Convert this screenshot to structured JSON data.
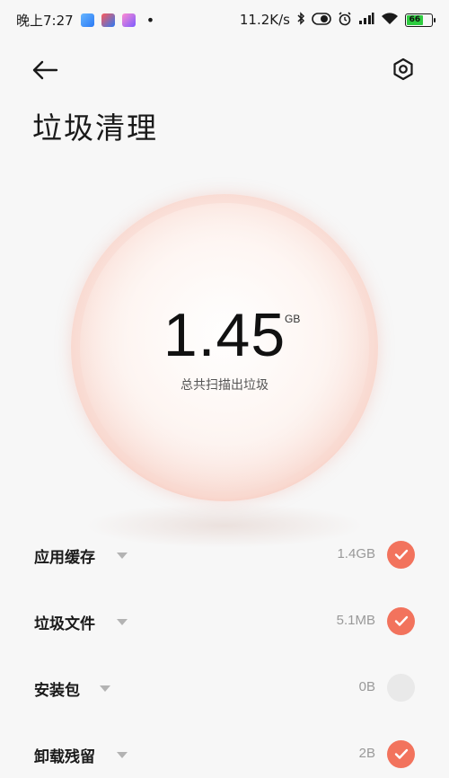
{
  "status_bar": {
    "time": "晚上7:27",
    "network_speed": "11.2K/s",
    "battery_level": "66",
    "icons": [
      "weather-app-icon",
      "calendar-app-icon",
      "gallery-app-icon",
      "bluetooth-icon",
      "toggle-icon",
      "alarm-icon",
      "signal-icon",
      "wifi-icon",
      "battery-icon"
    ]
  },
  "header": {
    "back_icon": "arrow-left-icon",
    "settings_icon": "hexagon-gear-icon",
    "title": "垃圾清理"
  },
  "summary": {
    "value": "1.45",
    "unit": "GB",
    "caption": "总共扫描出垃圾"
  },
  "items": [
    {
      "label": "应用缓存",
      "size": "1.4GB",
      "checked": true
    },
    {
      "label": "垃圾文件",
      "size": "5.1MB",
      "checked": true
    },
    {
      "label": "安装包",
      "size": "0B",
      "checked": false
    },
    {
      "label": "卸载残留",
      "size": "2B",
      "checked": true
    }
  ],
  "colors": {
    "accent": "#f2735d",
    "orb_edge": "#f08878",
    "background": "#f7f7f7"
  }
}
